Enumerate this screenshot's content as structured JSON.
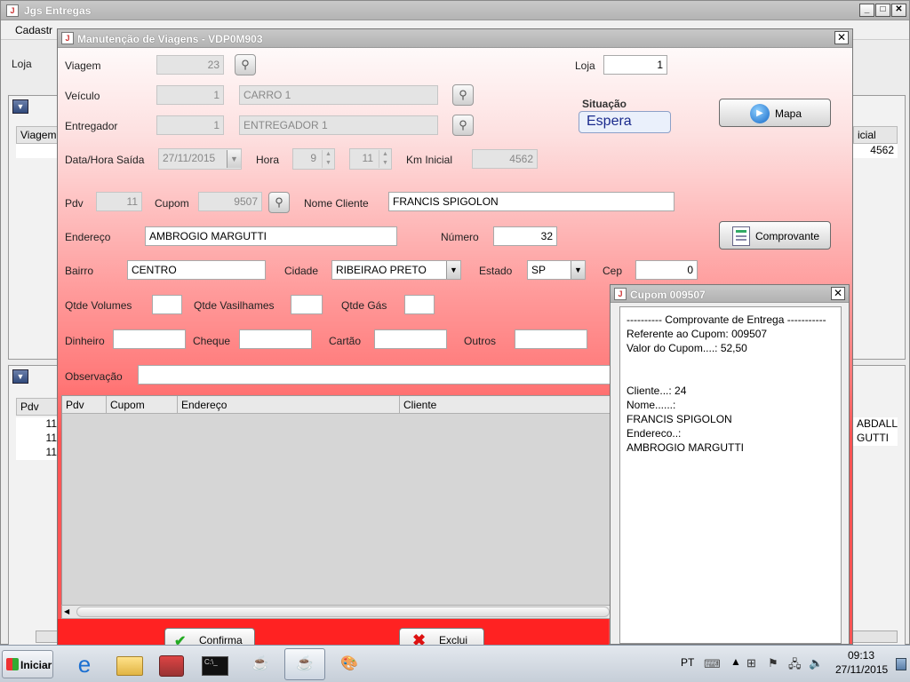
{
  "app": {
    "title": "Jgs Entregas",
    "menu_first": "Cadastr",
    "loja_label": "Loja",
    "panel1": {
      "col_viagem": "Viagem",
      "col_km": "icial",
      "km_value": "4562"
    },
    "panel2": {
      "col_pdv": "Pdv",
      "rows": [
        "11",
        "11",
        "11"
      ],
      "right_rows": [
        "ABDALL",
        "GUTTI"
      ]
    }
  },
  "dialog": {
    "title": "Manutenção de Viagens - VDP0M903",
    "viagem_label": "Viagem",
    "viagem": "23",
    "loja_label": "Loja",
    "loja": "1",
    "veiculo_label": "Veículo",
    "veiculo_cod": "1",
    "veiculo_desc": "CARRO 1",
    "entregador_label": "Entregador",
    "entregador_cod": "1",
    "entregador_desc": "ENTREGADOR 1",
    "situacao_label": "Situação",
    "situacao": "Espera",
    "mapa_btn": "Mapa",
    "data_label": "Data/Hora Saída",
    "data": "27/11/2015",
    "hora_label": "Hora",
    "hora": "9",
    "minuto": "11",
    "km_label": "Km Inicial",
    "km": "4562",
    "pdv_label": "Pdv",
    "pdv": "11",
    "cupom_label": "Cupom",
    "cupom": "9507",
    "nome_label": "Nome Cliente",
    "nome": "FRANCIS SPIGOLON",
    "endereco_label": "Endereço",
    "endereco": "AMBROGIO MARGUTTI",
    "numero_label": "Número",
    "numero": "32",
    "comprovante_btn": "Comprovante",
    "bairro_label": "Bairro",
    "bairro": "CENTRO",
    "cidade_label": "Cidade",
    "cidade": "RIBEIRAO PRETO",
    "estado_label": "Estado",
    "estado": "SP",
    "cep_label": "Cep",
    "cep": "0",
    "qtde_volumes_label": "Qtde Volumes",
    "qtde_vasilhames_label": "Qtde Vasilhames",
    "qtde_gas_label": "Qtde Gás",
    "dinheiro_label": "Dinheiro",
    "cheque_label": "Cheque",
    "cartao_label": "Cartão",
    "outros_label": "Outros",
    "observacao_label": "Observação",
    "table_headers": [
      "Pdv",
      "Cupom",
      "Endereço",
      "Cliente"
    ],
    "confirma_btn": "Confirma",
    "exclui_btn": "Exclui"
  },
  "popup": {
    "title": "Cupom 009507",
    "lines": "---------- Comprovante de Entrega -----------\nReferente ao Cupom: 009507\nValor do Cupom....: 52,50\n\n\nCliente...: 24\nNome......:\nFRANCIS SPIGOLON\nEndereco..:\nAMBROGIO MARGUTTI"
  },
  "taskbar": {
    "start": "Iniciar",
    "lang": "PT",
    "time": "09:13",
    "date": "27/11/2015"
  },
  "colors": {
    "dialog_gradient_bottom": "#ff5555",
    "situacao_text": "#1a2a8c"
  }
}
